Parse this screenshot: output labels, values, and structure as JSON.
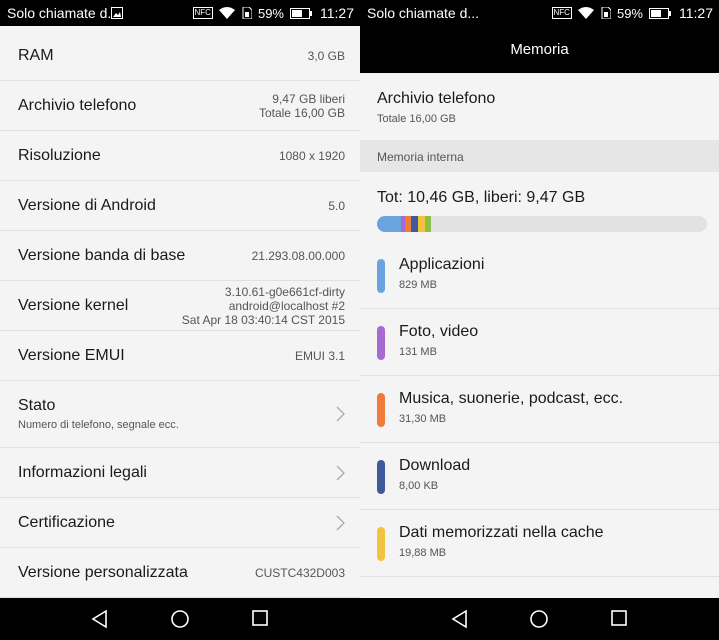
{
  "status": {
    "left_title": "Solo chiamate d...",
    "right_title": "Solo chiamate d...",
    "battery": "59%",
    "time": "11:27",
    "nfc": "NFC"
  },
  "left": {
    "rows": [
      {
        "label": "RAM",
        "value": "3,0 GB"
      },
      {
        "label": "Archivio telefono",
        "value1": "9,47  GB liberi",
        "value2": "Totale 16,00  GB"
      },
      {
        "label": "Risoluzione",
        "value": "1080 x 1920"
      },
      {
        "label": "Versione di Android",
        "value": "5.0"
      },
      {
        "label": "Versione banda di base",
        "value": "21.293.08.00.000"
      },
      {
        "label": "Versione kernel",
        "value1": "3.10.61-g0e661cf-dirty",
        "value2": "android@localhost #2",
        "value3": "Sat Apr 18 03:40:14 CST 2015"
      },
      {
        "label": "Versione EMUI",
        "value": "EMUI 3.1"
      },
      {
        "label": "Stato",
        "sub": "Numero di telefono, segnale ecc."
      },
      {
        "label": "Informazioni legali"
      },
      {
        "label": "Certificazione"
      },
      {
        "label": "Versione personalizzata",
        "value": "CUSTC432D003"
      }
    ]
  },
  "right": {
    "title": "Memoria",
    "archive_title": "Archivio telefono",
    "archive_sub": "Totale 16,00  GB",
    "section": "Memoria interna",
    "total": "Tot: 10,46 GB, liberi: 9,47 GB",
    "bar_segments": [
      {
        "color": "#6aa3e0",
        "fraction": 0.074
      },
      {
        "color": "#a56bd0",
        "fraction": 0.012
      },
      {
        "color": "#f07c3c",
        "fraction": 0.018
      },
      {
        "color": "#3f5a9a",
        "fraction": 0.02
      },
      {
        "color": "#f3c23f",
        "fraction": 0.02
      },
      {
        "color": "#8bbf4a",
        "fraction": 0.018
      }
    ],
    "categories": [
      {
        "name": "Applicazioni",
        "size": "829 MB",
        "color": "#6aa3e0"
      },
      {
        "name": "Foto, video",
        "size": "131 MB",
        "color": "#a56bd0"
      },
      {
        "name": "Musica, suonerie, podcast, ecc.",
        "size": "31,30 MB",
        "color": "#f07c3c"
      },
      {
        "name": "Download",
        "size": "8,00 KB",
        "color": "#3f5a9a"
      },
      {
        "name": "Dati memorizzati nella cache",
        "size": "19,88 MB",
        "color": "#f3c23f"
      }
    ]
  },
  "nav": {
    "back": "back-icon",
    "home": "home-icon",
    "recents": "recents-icon"
  }
}
